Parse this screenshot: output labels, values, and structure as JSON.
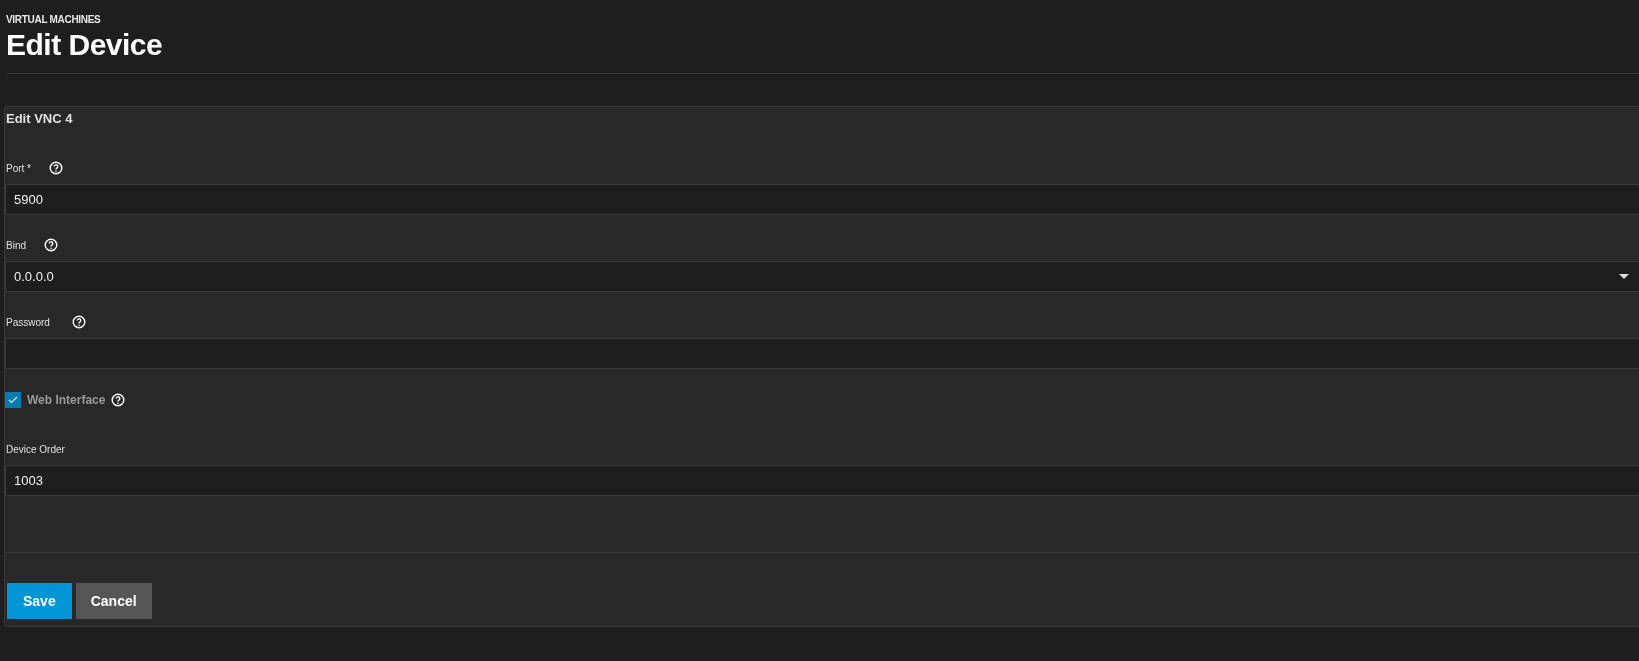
{
  "header": {
    "breadcrumb": "VIRTUAL MACHINES",
    "title": "Edit Device"
  },
  "form": {
    "title": "Edit VNC 4",
    "fields": [
      {
        "kind": "input",
        "label": "Port *",
        "help": true,
        "value": "5900"
      },
      {
        "kind": "select",
        "label": "Bind",
        "help": true,
        "value": "0.0.0.0"
      },
      {
        "kind": "input",
        "label": "Password",
        "help": true
      },
      {
        "kind": "checkbox",
        "label": "Web Interface",
        "help": true,
        "checked": true
      },
      {
        "kind": "input",
        "label": "Device Order",
        "help": false,
        "value": "1003"
      }
    ],
    "buttons": [
      {
        "label": "Save",
        "kind": "primary"
      },
      {
        "label": "Cancel",
        "kind": "secondary"
      }
    ]
  }
}
